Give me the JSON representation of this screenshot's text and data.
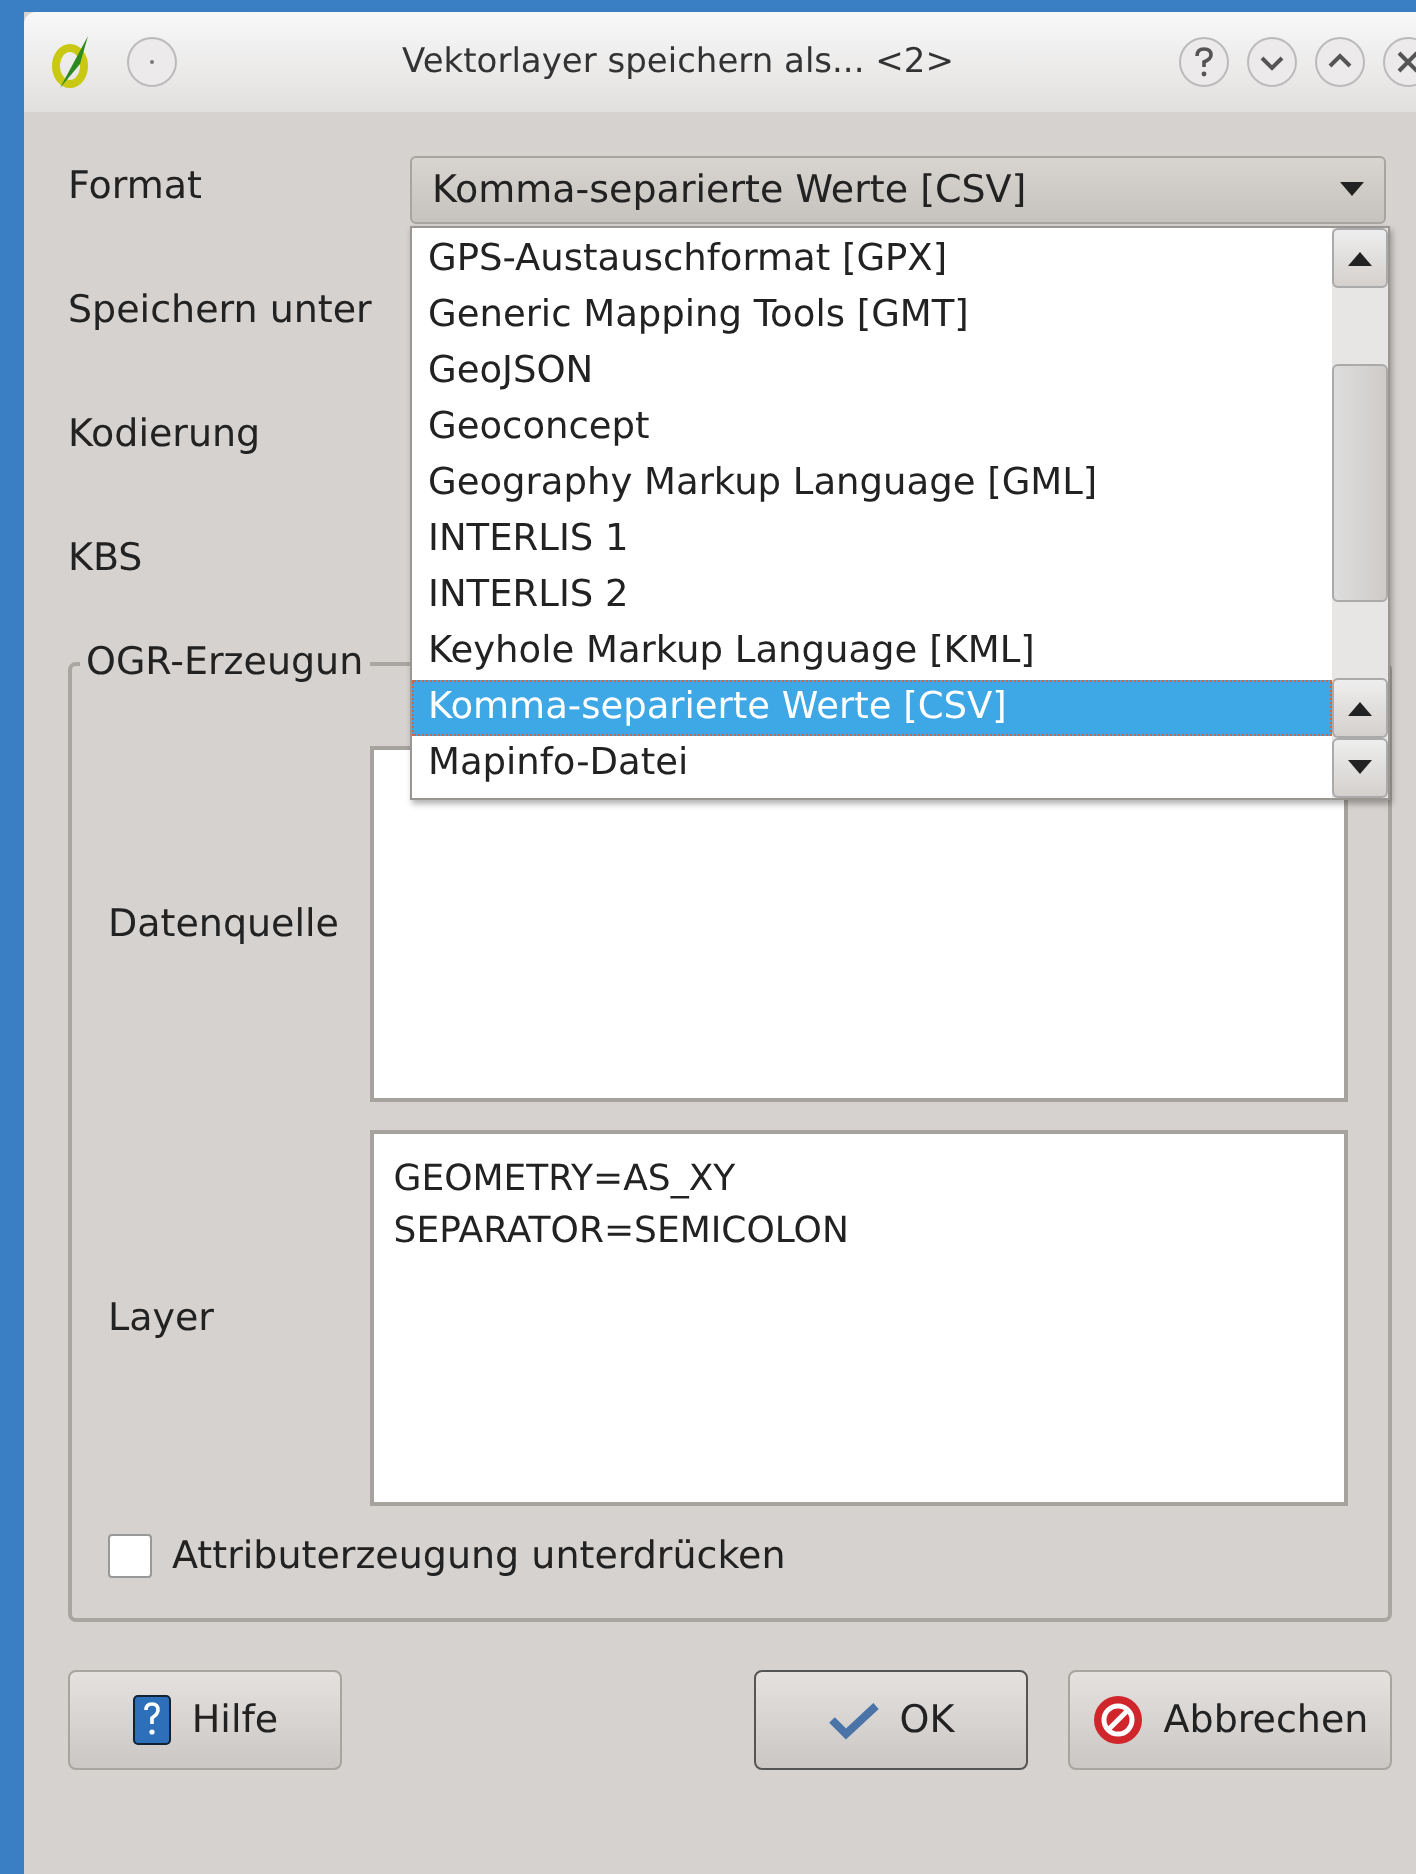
{
  "window": {
    "title": "Vektorlayer speichern als... <2>"
  },
  "format": {
    "label": "Format",
    "value": "Komma-separierte Werte [CSV]"
  },
  "rows": [
    {
      "label": "Speichern unter"
    },
    {
      "label": "Kodierung"
    },
    {
      "label": "KBS"
    }
  ],
  "dropdown": {
    "options": [
      {
        "label": "GPS-Austauschformat [GPX]",
        "selected": false
      },
      {
        "label": "Generic Mapping Tools [GMT]",
        "selected": false
      },
      {
        "label": "GeoJSON",
        "selected": false
      },
      {
        "label": "Geoconcept",
        "selected": false
      },
      {
        "label": "Geography Markup Language [GML]",
        "selected": false
      },
      {
        "label": "INTERLIS 1",
        "selected": false
      },
      {
        "label": "INTERLIS 2",
        "selected": false
      },
      {
        "label": "Keyhole Markup Language [KML]",
        "selected": false
      },
      {
        "label": "Komma-separierte Werte [CSV]",
        "selected": true
      },
      {
        "label": "Mapinfo-Datei",
        "selected": false
      }
    ]
  },
  "ogr_group": {
    "title": "OGR-Erzeugun",
    "datasource": {
      "label": "Datenquelle"
    },
    "layer": {
      "label": "Layer",
      "lines": [
        "GEOMETRY=AS_XY",
        "SEPARATOR=SEMICOLON"
      ]
    }
  },
  "checkbox": {
    "label": "Attributerzeugung unterdrücken",
    "checked": false
  },
  "buttons": [
    {
      "kind": "help",
      "label": "Hilfe"
    },
    {
      "kind": "ok",
      "label": "OK"
    },
    {
      "kind": "cancel",
      "label": "Abbrechen"
    }
  ]
}
